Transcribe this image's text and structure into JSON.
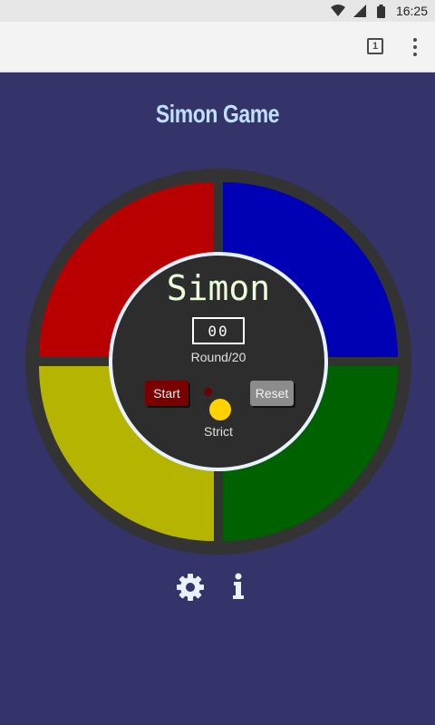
{
  "status_bar": {
    "time": "16:25",
    "icons": [
      "wifi-icon",
      "signal-icon",
      "battery-icon"
    ]
  },
  "browser_toolbar": {
    "tab_count": "1",
    "icons": [
      "tab-switcher-icon",
      "overflow-menu-icon"
    ]
  },
  "page": {
    "title": "Simon Game"
  },
  "game": {
    "center_title": "Simon",
    "count_display": "00",
    "round_label": "Round/20",
    "start_label": "Start",
    "reset_label": "Reset",
    "strict_label": "Strict",
    "quadrant_colors": {
      "red": "#b80000",
      "blue": "#0000b5",
      "yellow": "#b5b400",
      "green": "#006100"
    },
    "strict_led_color": "#6e0000",
    "strict_button_color": "#ffd200"
  },
  "footer": {
    "icons": [
      "settings-gear-icon",
      "info-icon"
    ]
  },
  "colors": {
    "background": "#34336a",
    "title": "#bfe0ff"
  }
}
